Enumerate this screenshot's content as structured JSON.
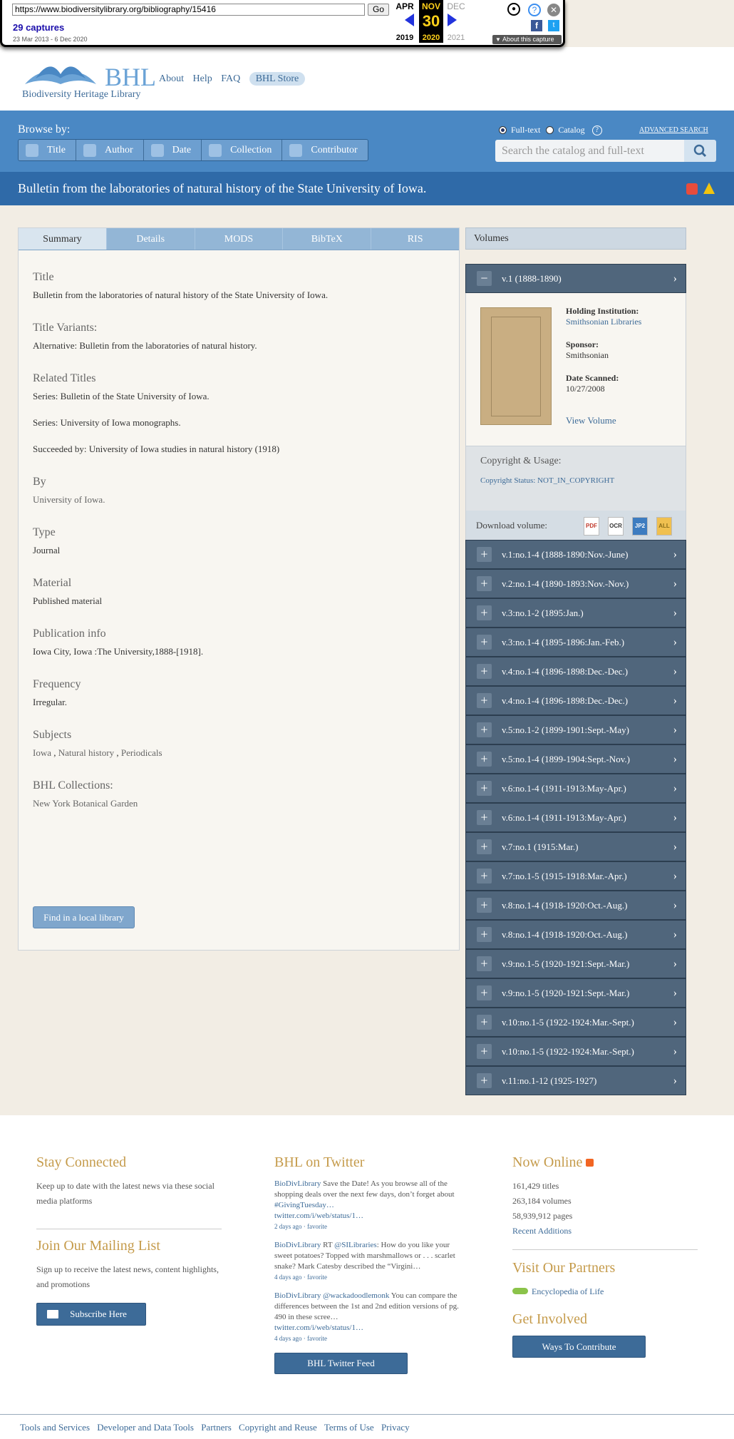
{
  "wayback": {
    "url": "https://www.biodiversitylibrary.org/bibliography/15416",
    "go": "Go",
    "captures": "29 captures",
    "range": "23 Mar 2013 - 6 Dec 2020",
    "prev_month": "APR",
    "cur_month": "NOV",
    "next_month": "DEC",
    "day": "30",
    "prev_year": "2019",
    "cur_year": "2020",
    "next_year": "2021",
    "about": "About this capture"
  },
  "header": {
    "logo": "BHL",
    "logo_sub": "Biodiversity Heritage Library",
    "nav": [
      "About",
      "Help",
      "FAQ",
      "BHL Store"
    ]
  },
  "browse": {
    "label": "Browse by:",
    "buttons": [
      "Title",
      "Author",
      "Date",
      "Collection",
      "Contributor"
    ],
    "opt_fulltext": "Full-text",
    "opt_catalog": "Catalog",
    "advanced": "ADVANCED SEARCH",
    "placeholder": "Search the catalog and full-text"
  },
  "page_title": "Bulletin from the laboratories of natural history of the State University of Iowa.",
  "tabs": [
    "Summary",
    "Details",
    "MODS",
    "BibTeX",
    "RIS"
  ],
  "summary": {
    "title_h": "Title",
    "title_v": "Bulletin from the laboratories of natural history of the State University of Iowa.",
    "variants_h": "Title Variants:",
    "variants_v": "Alternative: Bulletin from the laboratories of natural history.",
    "related_h": "Related Titles",
    "related_1": "Series: Bulletin of the State University of Iowa.",
    "related_2": "Series: University of Iowa monographs.",
    "related_3": "Succeeded by: University of Iowa studies in natural history (1918)",
    "by_h": "By",
    "by_v": "University of Iowa.",
    "type_h": "Type",
    "type_v": "Journal",
    "material_h": "Material",
    "material_v": "Published material",
    "pub_h": "Publication info",
    "pub_v": "Iowa City, Iowa :The University,1888-[1918].",
    "freq_h": "Frequency",
    "freq_v": "Irregular.",
    "subjects_h": "Subjects",
    "subjects": [
      "Iowa",
      "Natural history",
      "Periodicals"
    ],
    "coll_h": "BHL Collections:",
    "coll_v": "New York Botanical Garden",
    "local_btn": "Find in a local library"
  },
  "volumes": {
    "header": "Volumes",
    "open": "v.1 (1888-1890)",
    "holding_h": "Holding Institution:",
    "holding_v": "Smithsonian Libraries",
    "sponsor_h": "Sponsor:",
    "sponsor_v": "Smithsonian",
    "scanned_h": "Date Scanned:",
    "scanned_v": "10/27/2008",
    "view": "View Volume",
    "copyright_h": "Copyright & Usage:",
    "copyright_s": "Copyright Status: NOT_IN_COPYRIGHT",
    "download": "Download volume:",
    "dl_icons": [
      "PDF",
      "OCR",
      "JP2",
      "ALL"
    ],
    "list": [
      "v.1:no.1-4 (1888-1890:Nov.-June)",
      "v.2:no.1-4 (1890-1893:Nov.-Nov.)",
      "v.3:no.1-2 (1895:Jan.)",
      "v.3:no.1-4 (1895-1896:Jan.-Feb.)",
      "v.4:no.1-4 (1896-1898:Dec.-Dec.)",
      "v.4:no.1-4 (1896-1898:Dec.-Dec.)",
      "v.5:no.1-2 (1899-1901:Sept.-May)",
      "v.5:no.1-4 (1899-1904:Sept.-Nov.)",
      "v.6:no.1-4 (1911-1913:May-Apr.)",
      "v.6:no.1-4 (1911-1913:May-Apr.)",
      "v.7:no.1 (1915:Mar.)",
      "v.7:no.1-5 (1915-1918:Mar.-Apr.)",
      "v.8:no.1-4 (1918-1920:Oct.-Aug.)",
      "v.8:no.1-4 (1918-1920:Oct.-Aug.)",
      "v.9:no.1-5 (1920-1921:Sept.-Mar.)",
      "v.9:no.1-5 (1920-1921:Sept.-Mar.)",
      "v.10:no.1-5 (1922-1924:Mar.-Sept.)",
      "v.10:no.1-5 (1922-1924:Mar.-Sept.)",
      "v.11:no.1-12 (1925-1927)"
    ]
  },
  "footer": {
    "stay_h": "Stay Connected",
    "stay_p": "Keep up to date with the latest news via these social media platforms",
    "mail_h": "Join Our Mailing List",
    "mail_p": "Sign up to receive the latest news, content highlights, and promotions",
    "subscribe": "Subscribe Here",
    "twitter_h": "BHL on Twitter",
    "tweets": [
      {
        "user": "BioDivLibrary",
        "text": " Save the Date! As you browse all of the shopping deals over the next few days, don’t forget about ",
        "tag": "#GivingTuesday…",
        "link": "twitter.com/i/web/status/1…",
        "meta": "2 days ago · favorite"
      },
      {
        "user": "BioDivLibrary",
        "text": " RT ",
        "tag": "@SILibraries",
        "rest": ": How do you like your sweet potatoes? Topped with marshmallows or . . . scarlet snake? Mark Catesby described the “Virgini…",
        "meta": "4 days ago · favorite"
      },
      {
        "user": "BioDivLibrary",
        "text": " ",
        "tag": "@wackadoodlemonk",
        "rest": " You can compare the differences between the 1st and 2nd edition versions of pg. 490 in these scree…",
        "link": "twitter.com/i/web/status/1…",
        "meta": "4 days ago · favorite"
      }
    ],
    "feed_btn": "BHL Twitter Feed",
    "online_h": "Now Online",
    "titles": "161,429 titles",
    "volumes": "263,184 volumes",
    "pages": "58,939,912 pages",
    "recent": "Recent Additions",
    "partners_h": "Visit Our Partners",
    "eol": "Encyclopedia of Life",
    "involved_h": "Get Involved",
    "contribute": "Ways To Contribute",
    "links": [
      "Tools and Services",
      "Developer and Data Tools",
      "Partners",
      "Copyright and Reuse",
      "Terms of Use",
      "Privacy"
    ]
  },
  "colors": {
    "brand_blue": "#4a88c4",
    "title_bar": "#2f6aa8",
    "volume_row": "#50667c",
    "footer_heading": "#c59b4b"
  }
}
